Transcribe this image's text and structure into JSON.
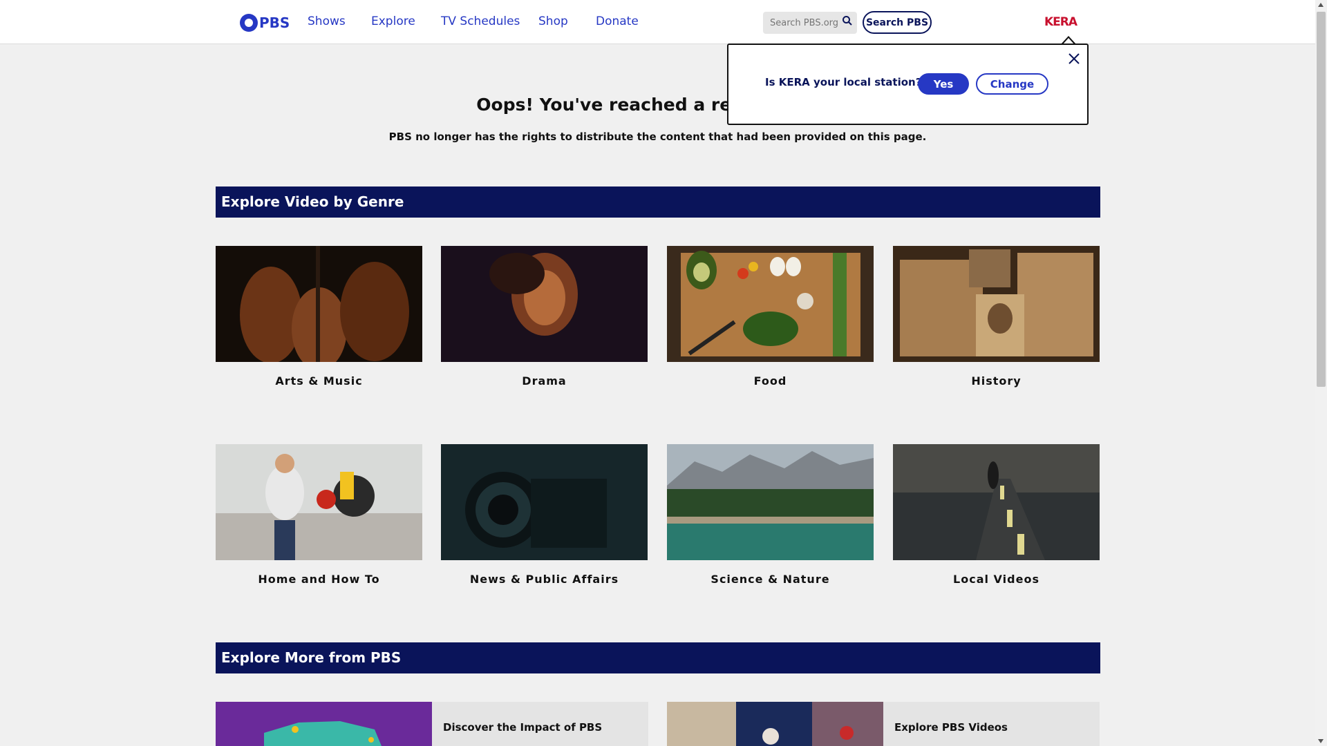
{
  "header": {
    "logo_text": "PBS",
    "nav": [
      "Shows",
      "Explore",
      "TV Schedules",
      "Shop",
      "Donate"
    ],
    "search_placeholder": "Search PBS.org",
    "search_button": "Search PBS",
    "station": "KERA"
  },
  "main": {
    "title": "Oops! You've reached a retired page.",
    "subtitle": "PBS no longer has the rights to distribute the content that had been provided on this page."
  },
  "genres": {
    "heading": "Explore Video by Genre",
    "items": [
      {
        "label": "Arts & Music"
      },
      {
        "label": "Drama"
      },
      {
        "label": "Food"
      },
      {
        "label": "History"
      },
      {
        "label": "Home and How To"
      },
      {
        "label": "News & Public Affairs"
      },
      {
        "label": "Science & Nature"
      },
      {
        "label": "Local Videos"
      }
    ]
  },
  "more": {
    "heading": "Explore More from PBS",
    "items": [
      {
        "label": "Discover the Impact of PBS"
      },
      {
        "label": "Explore PBS Videos"
      }
    ]
  },
  "popup": {
    "question": "Is KERA your local station?",
    "yes": "Yes",
    "change": "Change"
  },
  "colors": {
    "brand_blue": "#2638c4",
    "navy": "#0a145a",
    "station_red": "#c8102e"
  }
}
